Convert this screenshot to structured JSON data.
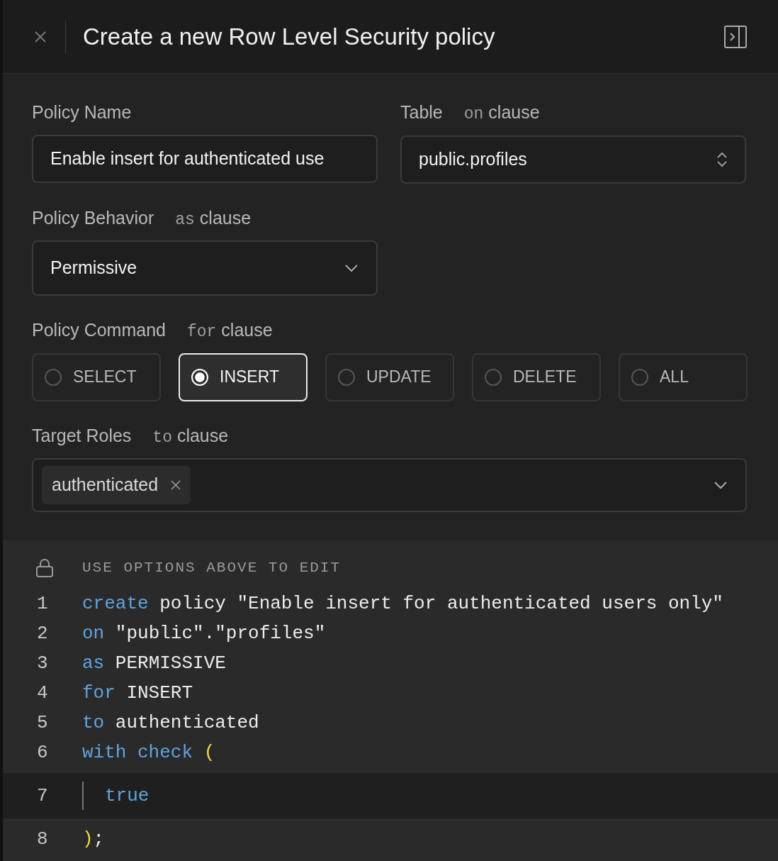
{
  "header": {
    "title": "Create a new Row Level Security policy"
  },
  "policy_name": {
    "label": "Policy Name",
    "value": "Enable insert for authenticated use"
  },
  "table": {
    "label": "Table",
    "clause_keyword": "on",
    "clause": "clause",
    "value": "public.profiles"
  },
  "policy_behavior": {
    "label": "Policy Behavior",
    "clause_keyword": "as",
    "clause": "clause",
    "value": "Permissive"
  },
  "policy_command": {
    "label": "Policy Command",
    "clause_keyword": "for",
    "clause": "clause",
    "options": [
      {
        "label": "SELECT",
        "selected": false
      },
      {
        "label": "INSERT",
        "selected": true
      },
      {
        "label": "UPDATE",
        "selected": false
      },
      {
        "label": "DELETE",
        "selected": false
      },
      {
        "label": "ALL",
        "selected": false
      }
    ]
  },
  "target_roles": {
    "label": "Target Roles",
    "clause_keyword": "to",
    "clause": "clause",
    "tags": [
      "authenticated"
    ]
  },
  "editor": {
    "notice": "USE OPTIONS ABOVE TO EDIT",
    "lines": [
      {
        "number": "1",
        "active": false,
        "tokens": [
          {
            "kind": "keyword",
            "text": "create"
          },
          {
            "kind": "plain",
            "text": " policy \"Enable insert for authenticated users only\""
          }
        ]
      },
      {
        "number": "2",
        "active": false,
        "tokens": [
          {
            "kind": "keyword",
            "text": "on"
          },
          {
            "kind": "plain",
            "text": " \"public\".\"profiles\""
          }
        ]
      },
      {
        "number": "3",
        "active": false,
        "tokens": [
          {
            "kind": "keyword",
            "text": "as"
          },
          {
            "kind": "plain",
            "text": " PERMISSIVE"
          }
        ]
      },
      {
        "number": "4",
        "active": false,
        "tokens": [
          {
            "kind": "keyword",
            "text": "for"
          },
          {
            "kind": "plain",
            "text": " INSERT"
          }
        ]
      },
      {
        "number": "5",
        "active": false,
        "tokens": [
          {
            "kind": "keyword",
            "text": "to"
          },
          {
            "kind": "plain",
            "text": " authenticated"
          }
        ]
      },
      {
        "number": "6",
        "active": false,
        "tokens": [
          {
            "kind": "keyword",
            "text": "with check "
          },
          {
            "kind": "paren",
            "text": "("
          }
        ]
      },
      {
        "number": "7",
        "active": true,
        "tokens": [
          {
            "kind": "keyword",
            "text": "true"
          }
        ]
      },
      {
        "number": "8",
        "active": false,
        "tokens": [
          {
            "kind": "paren",
            "text": ")"
          },
          {
            "kind": "plain",
            "text": ";"
          }
        ]
      }
    ]
  }
}
